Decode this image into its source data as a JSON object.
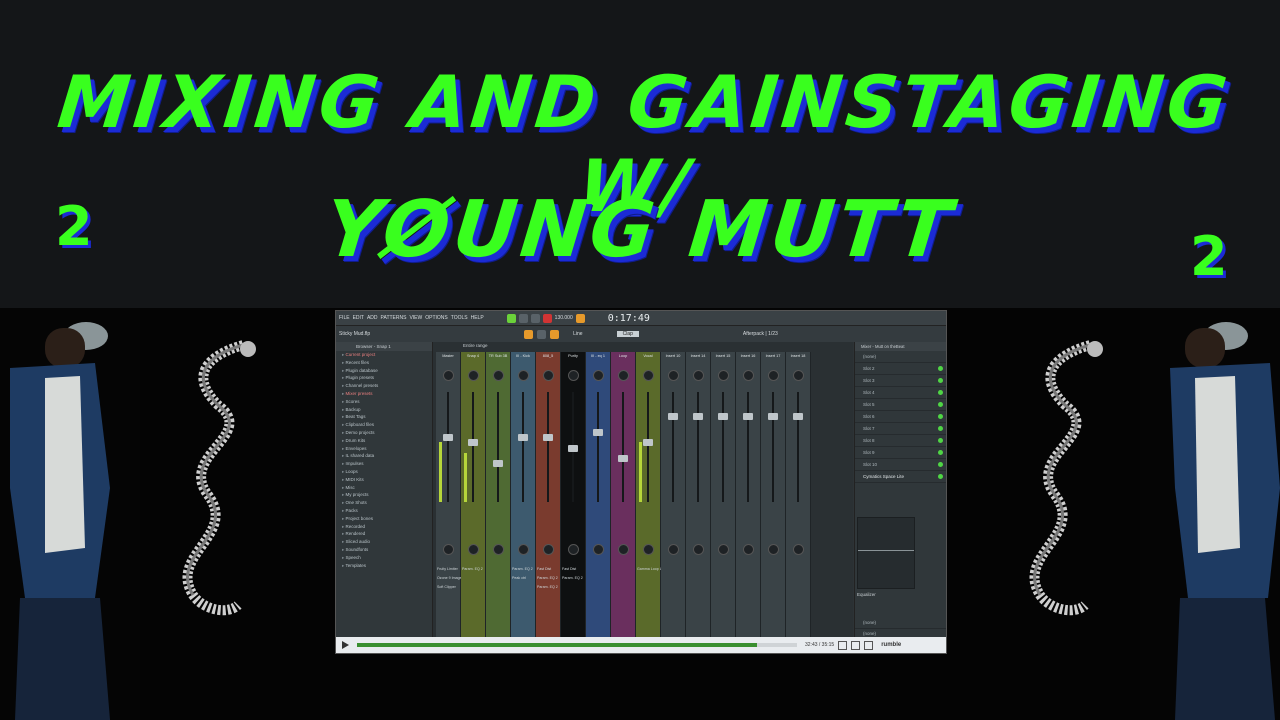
{
  "title": {
    "line1": "MIXING AND GAINSTAGING W/",
    "line2": "YØUNG MUTT",
    "side_left": "2",
    "side_right": "2"
  },
  "colors": {
    "title": "#39ff1e",
    "title_shadow": "#1b2bd6",
    "background": "#141618"
  },
  "daw": {
    "menu": [
      "FILE",
      "EDIT",
      "ADD",
      "PATTERNS",
      "VIEW",
      "OPTIONS",
      "TOOLS",
      "HELP"
    ],
    "tempo": "130.000",
    "time": "0:17:49",
    "hint": "Sticky Mud.flp",
    "snap": "Line",
    "clap": "Clap",
    "project_label": "Afterpack | 1/23",
    "project_sub": "Project breakdown",
    "browser_title": "Browser - Snap 1",
    "browser_items": [
      "Current project",
      "Recent files",
      "Plugin database",
      "Plugin presets",
      "Channel presets",
      "Mixer presets",
      "Scores",
      "Backup",
      "Beat Tags",
      "Clipboard files",
      "Demo projects",
      "Drum Kits",
      "Envelopes",
      "IL shared data",
      "Impulses",
      "Loops",
      "MIDI Kits",
      "Misc",
      "My projects",
      "One Shots",
      "Packs",
      "Project bones",
      "Recorded",
      "Rendered",
      "Sliced audio",
      "Soundfonts",
      "Speech",
      "Templates"
    ],
    "browser_highlight": [
      0,
      5
    ],
    "mixer_title": "Entire range",
    "strips": [
      {
        "name": "Master",
        "color": "#3a4347",
        "fader": 0.6,
        "meter": 0.55
      },
      {
        "name": "Snap 4",
        "color": "#5b6a2a",
        "fader": 0.55,
        "meter": 0.45
      },
      {
        "name": "TR Sub 3B",
        "color": "#4f6a33",
        "fader": 0.35,
        "meter": 0
      },
      {
        "name": "III - Kick",
        "color": "#3d5a6e",
        "fader": 0.6,
        "meter": 0
      },
      {
        "name": "808_5",
        "color": "#7a3b2e",
        "fader": 0.6,
        "meter": 0
      },
      {
        "name": "Purity",
        "color": "#0e1011",
        "fader": 0.5,
        "meter": 0
      },
      {
        "name": "III - eq 1",
        "color": "#2f4a7a",
        "fader": 0.65,
        "meter": 0
      },
      {
        "name": "Loop",
        "color": "#6a2f5e",
        "fader": 0.4,
        "meter": 0
      },
      {
        "name": "Vocal",
        "color": "#5a6a2a",
        "fader": 0.55,
        "meter": 0.55
      },
      {
        "name": "Insert 10",
        "color": "#3a4347",
        "fader": 0.8,
        "meter": 0
      },
      {
        "name": "Insert 14",
        "color": "#3a4347",
        "fader": 0.8,
        "meter": 0
      },
      {
        "name": "Insert 15",
        "color": "#3a4347",
        "fader": 0.8,
        "meter": 0
      },
      {
        "name": "Insert 16",
        "color": "#3a4347",
        "fader": 0.8,
        "meter": 0
      },
      {
        "name": "Insert 17",
        "color": "#3a4347",
        "fader": 0.8,
        "meter": 0
      },
      {
        "name": "Insert 18",
        "color": "#3a4347",
        "fader": 0.8,
        "meter": 0
      }
    ],
    "strip_inserts": [
      [
        "Fruity Limiter",
        "Ozone 9 Imager 2",
        "Soft Clipper"
      ],
      [
        "Param. EQ 2"
      ],
      [],
      [
        "Param. EQ 2",
        "Peak ctrl"
      ],
      [
        "Fast Dist",
        "Param. EQ 2",
        "Param. EQ 2"
      ],
      [
        "Fast Dist",
        "Param. EQ 2"
      ],
      [],
      [],
      [
        "Gamma Loop Lite"
      ]
    ],
    "side_panel_title": "Mixer - Mutt on theBeat",
    "side_select": "(none)",
    "slots": [
      "Slot 2",
      "Slot 3",
      "Slot 4",
      "Slot 5",
      "Slot 6",
      "Slot 7",
      "Slot 8",
      "Slot 9",
      "Slot 10"
    ],
    "active_slot": "Cymatics Space Lite",
    "equalizer_label": "Equalizer",
    "out1": "(none)",
    "out2": "(none)"
  },
  "player": {
    "time": "32:43 / 35:15",
    "progress": 0.91,
    "brand": "rumble"
  }
}
